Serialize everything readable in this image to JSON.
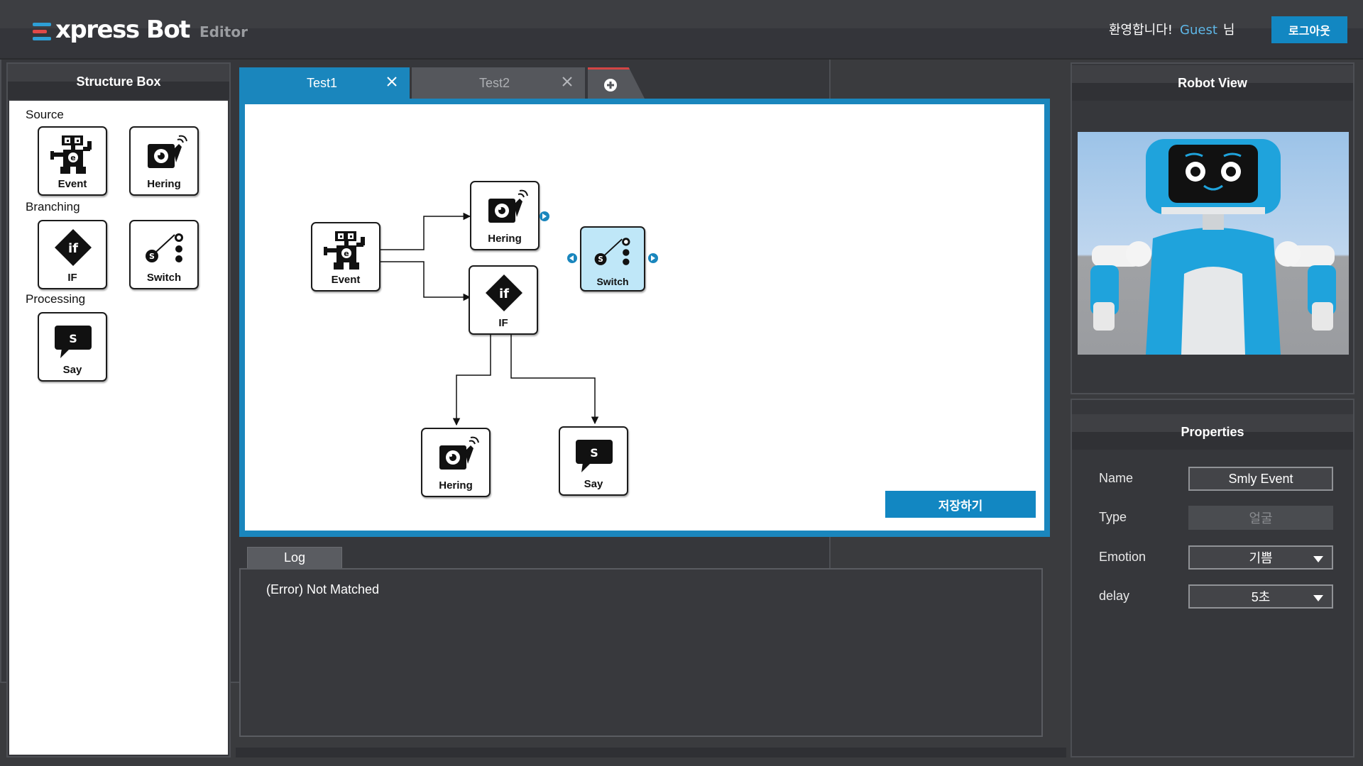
{
  "header": {
    "logo_text": "xpress Bot",
    "logo_sub": "Editor",
    "welcome_prefix": "환영합니다!",
    "user_name": "Guest",
    "welcome_suffix": "님",
    "logout_label": "로그아웃"
  },
  "structure_box": {
    "title": "Structure Box",
    "categories": [
      {
        "label": "Source",
        "blocks": [
          {
            "label": "Event",
            "icon": "robot-event-icon"
          },
          {
            "label": "Hering",
            "icon": "camera-hearing-icon"
          }
        ]
      },
      {
        "label": "Branching",
        "blocks": [
          {
            "label": "IF",
            "icon": "if-diamond-icon"
          },
          {
            "label": "Switch",
            "icon": "switch-icon"
          }
        ]
      },
      {
        "label": "Processing",
        "blocks": [
          {
            "label": "Say",
            "icon": "speech-bubble-icon"
          }
        ]
      }
    ]
  },
  "tabs": [
    {
      "label": "Test1",
      "active": true
    },
    {
      "label": "Test2",
      "active": false
    }
  ],
  "canvas": {
    "nodes": [
      {
        "label": "Event",
        "icon": "robot-event-icon"
      },
      {
        "label": "Hering",
        "icon": "camera-hearing-icon"
      },
      {
        "label": "IF",
        "icon": "if-diamond-icon"
      },
      {
        "label": "Switch",
        "icon": "switch-icon",
        "selected": true
      },
      {
        "label": "Hering",
        "icon": "camera-hearing-icon"
      },
      {
        "label": "Say",
        "icon": "speech-bubble-icon"
      }
    ],
    "save_label": "저장하기"
  },
  "log": {
    "tab_label": "Log",
    "lines": [
      "(Error) Not Matched"
    ]
  },
  "robot_view": {
    "title": "Robot View"
  },
  "properties": {
    "title": "Properties",
    "fields": [
      {
        "label": "Name",
        "value": "Smly Event",
        "kind": "text"
      },
      {
        "label": "Type",
        "value": "얼굴",
        "kind": "disabled"
      },
      {
        "label": "Emotion",
        "value": "기쁨",
        "kind": "select"
      },
      {
        "label": "delay",
        "value": "5초",
        "kind": "select"
      }
    ]
  },
  "colors": {
    "accent": "#1a86bd",
    "header_bg": "#3d3e42",
    "panel_bg": "#36373b",
    "selected_node": "#bfe7f8",
    "guest_text": "#5fb8e8",
    "add_tab_marker": "#d34545"
  }
}
